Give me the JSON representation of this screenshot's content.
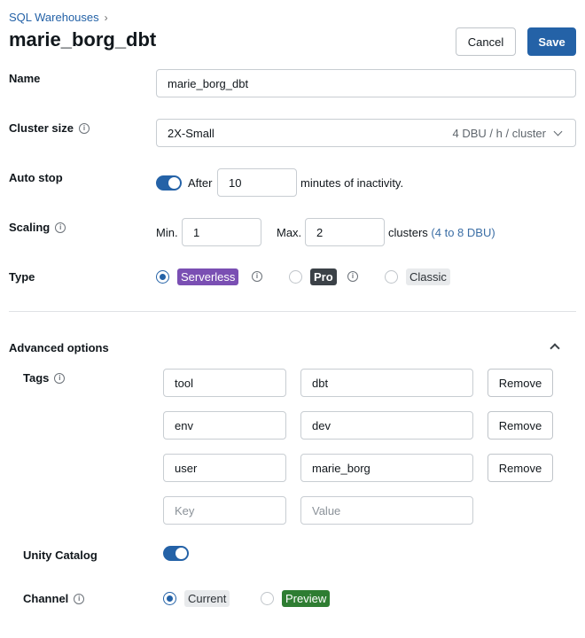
{
  "breadcrumb": {
    "parent": "SQL Warehouses",
    "separator": "›"
  },
  "page": {
    "title": "marie_borg_dbt"
  },
  "actions": {
    "cancel": "Cancel",
    "save": "Save"
  },
  "fields": {
    "name": {
      "label": "Name",
      "value": "marie_borg_dbt"
    },
    "cluster_size": {
      "label": "Cluster size",
      "value": "2X-Small",
      "detail": "4 DBU / h / cluster"
    },
    "auto_stop": {
      "label": "Auto stop",
      "enabled": true,
      "prefix": "After",
      "value": "10",
      "suffix": "minutes of inactivity."
    },
    "scaling": {
      "label": "Scaling",
      "min_label": "Min.",
      "min_value": "1",
      "max_label": "Max.",
      "max_value": "2",
      "suffix": "clusters",
      "dbu_range": "(4 to 8 DBU)"
    },
    "type": {
      "label": "Type",
      "options": [
        {
          "label": "Serverless",
          "selected": true
        },
        {
          "label": "Pro",
          "selected": false
        },
        {
          "label": "Classic",
          "selected": false
        }
      ]
    }
  },
  "advanced": {
    "title": "Advanced options",
    "expanded": true,
    "tags": {
      "label": "Tags",
      "rows": [
        {
          "key": "tool",
          "value": "dbt",
          "remove": "Remove"
        },
        {
          "key": "env",
          "value": "dev",
          "remove": "Remove"
        },
        {
          "key": "user",
          "value": "marie_borg",
          "remove": "Remove"
        }
      ],
      "new_key_placeholder": "Key",
      "new_value_placeholder": "Value"
    },
    "unity_catalog": {
      "label": "Unity Catalog",
      "enabled": true
    },
    "channel": {
      "label": "Channel",
      "options": [
        {
          "label": "Current",
          "selected": true
        },
        {
          "label": "Preview",
          "selected": false
        }
      ]
    }
  },
  "colors": {
    "primary": "#2462a7",
    "serverless_chip": "#7a4fb3",
    "pro_chip": "#3b4147",
    "classic_chip": "#e8eaec",
    "preview_chip": "#2e7d32"
  }
}
